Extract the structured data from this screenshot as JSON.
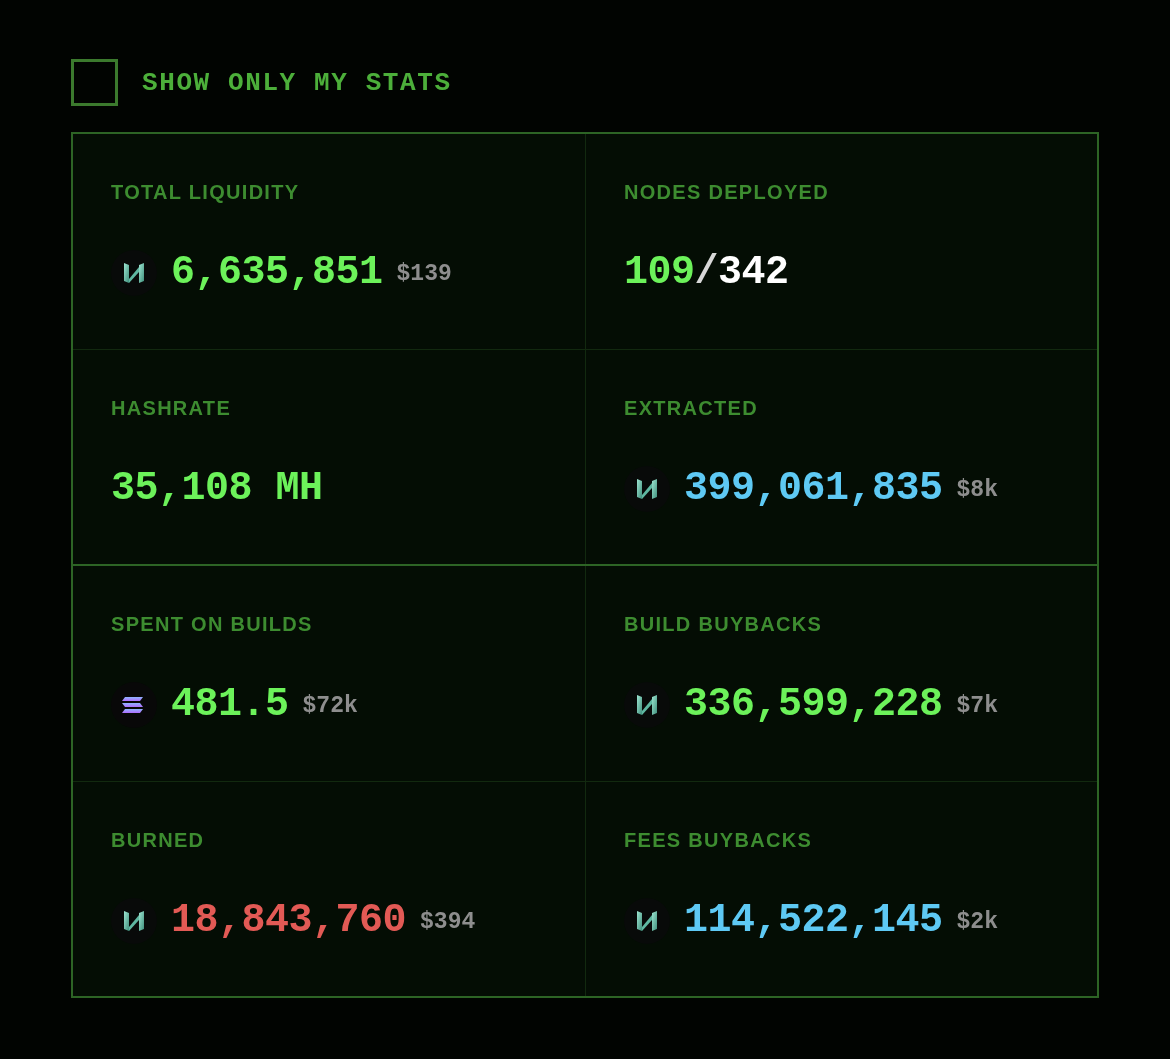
{
  "filter": {
    "label": "SHOW ONLY MY STATS",
    "checked": false
  },
  "sections": [
    {
      "stats": [
        {
          "label": "TOTAL LIQUIDITY",
          "kind": "coin",
          "value": "6,635,851",
          "color": "#6cf25a",
          "usd": "$139"
        },
        {
          "label": "NODES DEPLOYED",
          "kind": "ratio",
          "value": "109",
          "separator": "/",
          "total": "342",
          "color": "#6cf25a"
        },
        {
          "label": "HASHRATE",
          "kind": "plain",
          "value": "35,108 MH",
          "color": "#6cf25a"
        },
        {
          "label": "EXTRACTED",
          "kind": "coin",
          "value": "399,061,835",
          "color": "#5ec9f4",
          "usd": "$8k"
        }
      ]
    },
    {
      "stats": [
        {
          "label": "SPENT ON BUILDS",
          "kind": "striped-coin",
          "value": "481.5",
          "color": "#6cf25a",
          "usd": "$72k"
        },
        {
          "label": "BUILD BUYBACKS",
          "kind": "coin",
          "value": "336,599,228",
          "color": "#6cf25a",
          "usd": "$7k"
        },
        {
          "label": "BURNED",
          "kind": "coin",
          "value": "18,843,760",
          "color": "#e25a55",
          "usd": "$394"
        },
        {
          "label": "FEES BUYBACKS",
          "kind": "coin",
          "value": "114,522,145",
          "color": "#5ec9f4",
          "usd": "$2k"
        }
      ]
    }
  ]
}
